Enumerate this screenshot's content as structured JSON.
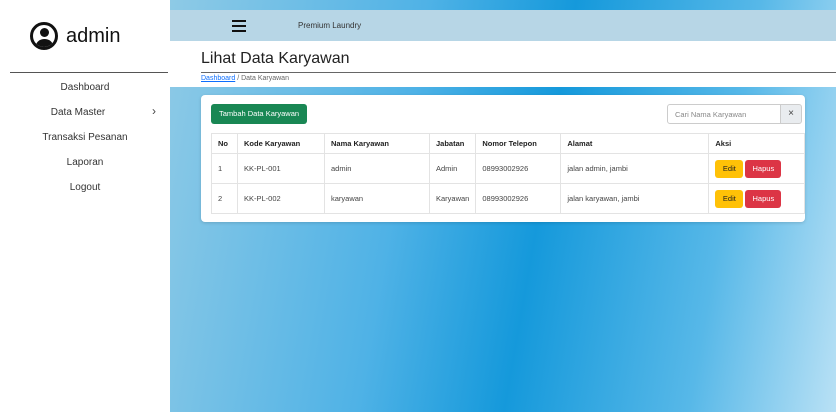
{
  "sidebar": {
    "brand": "admin",
    "items": [
      {
        "label": "Dashboard"
      },
      {
        "label": "Data Master"
      },
      {
        "label": "Transaksi Pesanan"
      },
      {
        "label": "Laporan"
      },
      {
        "label": "Logout"
      }
    ],
    "chevron": "›"
  },
  "topbar": {
    "title": "Premium Laundry"
  },
  "page": {
    "title": "Lihat Data Karyawan",
    "breadcrumb": {
      "link": "Dashboard",
      "separator": "/",
      "current": "Data Karyawan"
    }
  },
  "toolbar": {
    "add_label": "Tambah Data Karyawan",
    "search_placeholder": "Cari Nama Karyawan",
    "clear_label": "×"
  },
  "table": {
    "headers": [
      "No",
      "Kode Karyawan",
      "Nama Karyawan",
      "Jabatan",
      "Nomor Telepon",
      "Alamat",
      "Aksi"
    ],
    "rows": [
      {
        "no": "1",
        "kode": "KK-PL-001",
        "nama": "admin",
        "jabatan": "Admin",
        "telepon": "08993002926",
        "alamat": "jalan admin, jambi"
      },
      {
        "no": "2",
        "kode": "KK-PL-002",
        "nama": "karyawan",
        "jabatan": "Karyawan",
        "telepon": "08993002926",
        "alamat": "jalan karyawan, jambi"
      }
    ],
    "edit_label": "Edit",
    "delete_label": "Hapus"
  },
  "colors": {
    "add_button": "#198754",
    "edit_button": "#ffc107",
    "delete_button": "#dc3545",
    "topbar": "#b7d6e6"
  }
}
